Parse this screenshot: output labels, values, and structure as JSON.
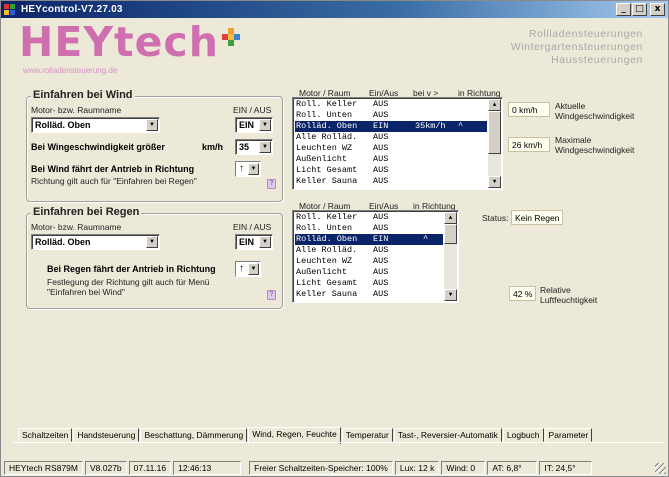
{
  "window": {
    "title": "HEYcontrol-V7.27.03",
    "min_label": "_",
    "max_label": "□",
    "close_label": "x"
  },
  "header": {
    "logo": "HEYtech",
    "url": "www.rolladensteuerung.de",
    "tagline": [
      "Rollladensteuerungen",
      "Wintergartensteuerungen",
      "Haussteuerungen"
    ]
  },
  "wind": {
    "title": "Einfahren bei Wind",
    "motor_label": "Motor- bzw. Raumname",
    "einaus_label": "EIN / AUS",
    "motor_value": "Rolläd. Oben",
    "einaus_value": "EIN",
    "speed_label": "Bei Wingeschwindigkeit größer",
    "speed_unit": "km/h",
    "speed_value": "35",
    "direction_label": "Bei Wind fährt der Antrieb in Richtung",
    "direction_value": "↑",
    "direction_note": "Richtung gilt auch für \"Einfahren bei Regen\"",
    "list_headers": [
      "Motor / Raum",
      "Ein/Aus",
      "bei v >",
      "in Richtung"
    ],
    "list_rows": [
      {
        "name": "Roll. Keller",
        "state": "AUS",
        "speed": "",
        "dir": ""
      },
      {
        "name": "Roll. Unten",
        "state": "AUS",
        "speed": "",
        "dir": ""
      },
      {
        "name": "Rolläd. Oben",
        "state": "EIN",
        "speed": "35km/h",
        "dir": "^"
      },
      {
        "name": "Alle Rolläd.",
        "state": "AUS",
        "speed": "",
        "dir": ""
      },
      {
        "name": "Leuchten WZ",
        "state": "AUS",
        "speed": "",
        "dir": ""
      },
      {
        "name": "Außenlicht",
        "state": "AUS",
        "speed": "",
        "dir": ""
      },
      {
        "name": "Licht Gesamt",
        "state": "AUS",
        "speed": "",
        "dir": ""
      },
      {
        "name": "Keller Sauna",
        "state": "AUS",
        "speed": "",
        "dir": ""
      }
    ],
    "current_value": "0 km/h",
    "current_label": [
      "Aktuelle",
      "Windgeschwindigkeit"
    ],
    "max_value": "26 km/h",
    "max_label": [
      "Maximale",
      "Windgeschwindigkeit"
    ]
  },
  "rain": {
    "title": "Einfahren bei Regen",
    "motor_label": "Motor- bzw. Raumname",
    "einaus_label": "EIN / AUS",
    "motor_value": "Rolläd. Oben",
    "einaus_value": "EIN",
    "direction_label": "Bei Regen fährt der Antrieb in Richtung",
    "direction_value": "↑",
    "direction_note": [
      "Festlegung der Richtung gilt auch für Menü",
      "\"Einfahren bei Wind\""
    ],
    "list_headers": [
      "Motor / Raum",
      "Ein/Aus",
      "in Richtung"
    ],
    "list_rows": [
      {
        "name": "Roll. Keller",
        "state": "AUS",
        "dir": ""
      },
      {
        "name": "Roll. Unten",
        "state": "AUS",
        "dir": ""
      },
      {
        "name": "Rolläd. Oben",
        "state": "EIN",
        "dir": "^"
      },
      {
        "name": "Alle Rolläd.",
        "state": "AUS",
        "dir": ""
      },
      {
        "name": "Leuchten WZ",
        "state": "AUS",
        "dir": ""
      },
      {
        "name": "Außenlicht",
        "state": "AUS",
        "dir": ""
      },
      {
        "name": "Licht Gesamt",
        "state": "AUS",
        "dir": ""
      },
      {
        "name": "Keller Sauna",
        "state": "AUS",
        "dir": ""
      }
    ],
    "status_label": "Status:",
    "status_value": "Kein Regen",
    "humidity_value": "42 %",
    "humidity_label": [
      "Relative",
      "Luftfeuchtigkeit"
    ]
  },
  "tabs": [
    {
      "label": "Schaltzeiten",
      "active": false
    },
    {
      "label": "Handsteuerung",
      "active": false
    },
    {
      "label": "Beschattung, Dämmerung",
      "active": false
    },
    {
      "label": "Wind, Regen, Feuchte",
      "active": true
    },
    {
      "label": "Temperatur",
      "active": false
    },
    {
      "label": "Tast-, Reversier-Automatik",
      "active": false
    },
    {
      "label": "Logbuch",
      "active": false
    },
    {
      "label": "Parameter",
      "active": false
    }
  ],
  "statusbar": {
    "device": "HEYtech RS879M",
    "version": "V8.027b",
    "date": "07.11.16",
    "time": "12:46:13",
    "memory": "Freier Schaltzeiten-Speicher: 100%",
    "lux": "Lux:  12 k",
    "wind": "Wind: 0",
    "at": "AT: 6,8°",
    "it": "IT: 24,5°"
  },
  "colors": {
    "logo": "#d06fb0",
    "selection": "#0a246a",
    "title_bar": "#0a246a"
  }
}
